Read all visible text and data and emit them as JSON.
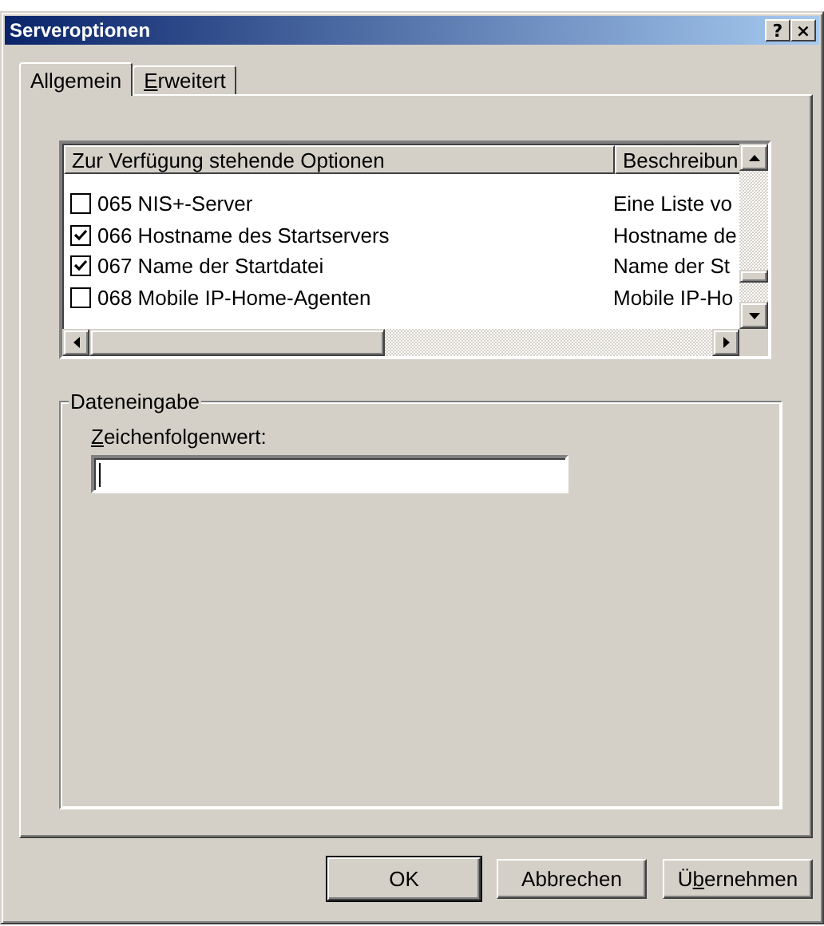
{
  "window": {
    "title": "Serveroptionen",
    "title_buttons": [
      "?",
      "×"
    ]
  },
  "tabs": [
    {
      "label": "Allgemein",
      "selected": true
    },
    {
      "selected": false,
      "access_key": "E",
      "label_rest": "rweitert"
    }
  ],
  "options_list": {
    "columns": [
      "Zur Verfügung stehende Optionen",
      "Beschreibun"
    ],
    "rows": [
      {
        "option": "065 NIS+-Server",
        "description": "Eine Liste vo",
        "checked": false
      },
      {
        "option": "066 Hostname des Startservers",
        "description": "Hostname de",
        "checked": true
      },
      {
        "option": "067 Name der Startdatei",
        "description": "Name der St",
        "checked": true
      },
      {
        "option": "068 Mobile IP-Home-Agenten",
        "description": "Mobile IP-Ho",
        "checked": false
      }
    ]
  },
  "data_entry": {
    "title": "Dateneingabe",
    "field_label_access_key": "Z",
    "field_label_rest": "eichenfolgenwert:",
    "focused": true
  },
  "buttons": [
    {
      "label": "OK",
      "default": true
    },
    {
      "label": "Abbrechen",
      "default": false
    },
    {
      "label": "Ü",
      "default": false,
      "access_key": "b",
      "label_rest": "ernehmen"
    }
  ]
}
